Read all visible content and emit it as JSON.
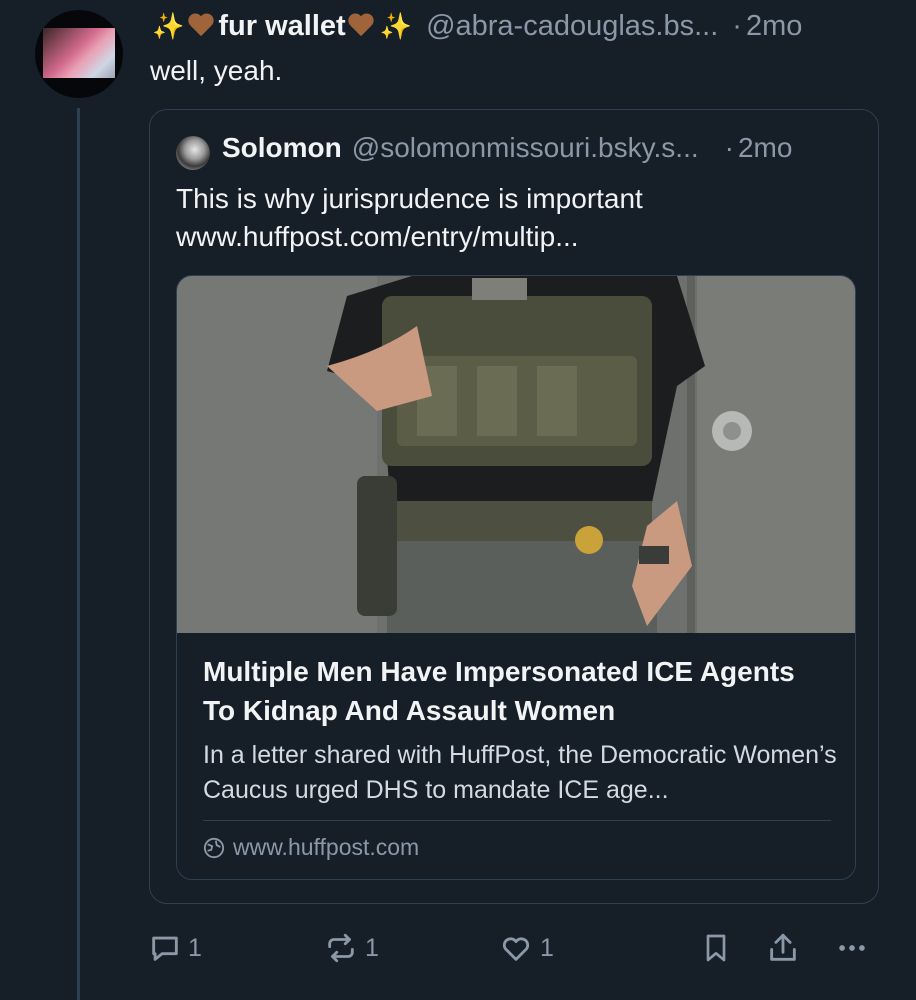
{
  "post": {
    "display_name": "fur wallet",
    "handle": "@abra-cadouglas.bs...",
    "dot": "·",
    "time": "2mo",
    "text": "well, yeah.",
    "sparkle_icon": "sparkles-icon",
    "heart_icon": "brown-heart-icon"
  },
  "quote": {
    "display_name": "Solomon",
    "handle": "@solomonmissouri.bsky.s...",
    "dot": "·",
    "time": "2mo",
    "text_line1": "This is why jurisprudence is important",
    "text_line2": "www.huffpost.com/entry/multip...",
    "card": {
      "title": "Multiple Men Have Impersonated ICE Agents To Kidnap And Assault Women",
      "description": "In a letter shared with HuffPost, the Democratic Women’s Caucus urged DHS to mandate ICE age...",
      "domain": "www.huffpost.com"
    }
  },
  "actions": {
    "reply_count": "1",
    "repost_count": "1",
    "like_count": "1"
  },
  "colors": {
    "background": "#161e27",
    "border": "#2e4052",
    "muted_text": "#8a98a8",
    "text": "#f1f3f5"
  }
}
